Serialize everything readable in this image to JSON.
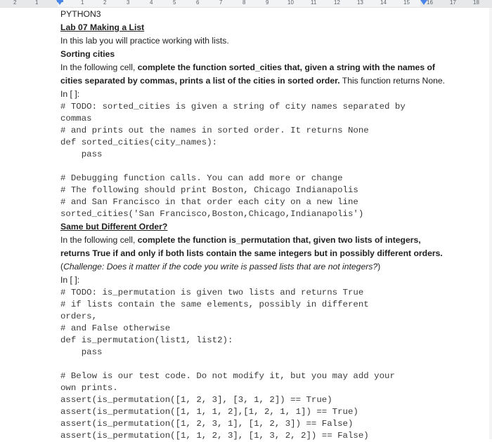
{
  "ruler": {
    "left_labels": [
      "2",
      "1"
    ],
    "labels": [
      "1",
      "2",
      "3",
      "4",
      "5",
      "6",
      "7",
      "8",
      "9",
      "10",
      "11",
      "12",
      "13",
      "14",
      "15",
      "16",
      "17",
      "18"
    ]
  },
  "doc": {
    "language": "PYTHON3",
    "title": "Lab 07 Making a List",
    "intro": "In this lab you will practice working with lists.",
    "section1": {
      "heading": "Sorting cities",
      "desc_plain1": "In the following cell, ",
      "desc_bold": "complete the function sorted_cities that, given a string with the names of",
      "desc_bold2": "cities separated by commas, prints a list of the cities in sorted order.",
      "desc_plain2": " This function returns None.",
      "cell_label": "In [ ]:",
      "code": [
        "# TODO: sorted_cities is given a string of city names separated by",
        "commas",
        "# and prints out the names in sorted order. It returns None",
        "def sorted_cities(city_names):",
        "    pass",
        "",
        "# Debugging function calls. You can add more or change",
        "# The following should print Boston, Chicago Indianapolis",
        "# and San Francisco in that order each city on a new line",
        "sorted_cities('San Francisco,Boston,Chicago,Indianapolis')"
      ]
    },
    "section2": {
      "heading": "Same but Different Order?",
      "desc_plain1": "In the following cell, ",
      "desc_bold": "complete the function is_permutation that, given two lists of integers,",
      "desc_bold2": "returns True if and only if both lists contain the same integers but in possibly different orders.",
      "challenge_open": "(",
      "challenge_italic": "Challenge: Does it matter if the code you write is passed lists that are not integers?",
      "challenge_close": ")",
      "cell_label": "In [ ]:",
      "code": [
        "# TODO: is_permutation is given two lists and returns True",
        "# if lists contain the same elements, possibly in different",
        "orders,",
        "# and False otherwise",
        "def is_permutation(list1, list2):",
        "    pass",
        "",
        "# Below is our test code. Do not modify it, but you may add your",
        "own prints.",
        "assert(is_permutation([1, 2, 3], [3, 1, 2]) == True)",
        "assert(is_permutation([1, 1, 1, 2],[1, 2, 1, 1]) == True)",
        "assert(is_permutation([1, 2, 3, 1], [1, 2, 3]) == False)",
        "assert(is_permutation([1, 1, 2, 3], [1, 3, 2, 2]) == False)"
      ]
    }
  }
}
